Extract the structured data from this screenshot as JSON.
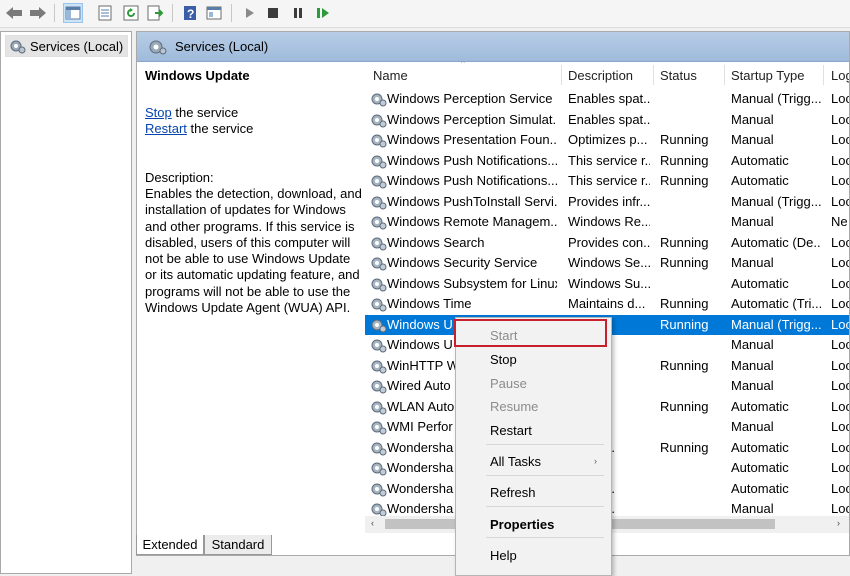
{
  "toolbar": {
    "icons": [
      "back-arrow-icon",
      "forward-arrow-icon",
      "show-hide-console-tree-icon",
      "properties-icon",
      "refresh-icon",
      "export-list-icon",
      "help-icon",
      "view-icon",
      "start-service-icon",
      "stop-service-icon",
      "pause-service-icon",
      "resume-service-icon"
    ]
  },
  "tree": {
    "item_label": "Services (Local)"
  },
  "pane": {
    "title": "Services (Local)"
  },
  "details": {
    "service_name": "Windows Update",
    "stop_link": "Stop",
    "stop_suffix": " the service",
    "restart_link": "Restart",
    "restart_suffix": " the service",
    "description_label": "Description:",
    "description_text": "Enables the detection, download, and installation of updates for Windows and other programs. If this service is disabled, users of this computer will not be able to use Windows Update or its automatic updating feature, and programs will not be able to use the Windows Update Agent (WUA) API."
  },
  "columns": [
    "Name",
    "Description",
    "Status",
    "Startup Type",
    "Log"
  ],
  "rows": [
    {
      "name": "Windows Perception Service",
      "desc": "Enables spat...",
      "status": "",
      "startup": "Manual (Trigg...",
      "log": "Loc"
    },
    {
      "name": "Windows Perception Simulat...",
      "desc": "Enables spat...",
      "status": "",
      "startup": "Manual",
      "log": "Loc"
    },
    {
      "name": "Windows Presentation Foun...",
      "desc": "Optimizes p...",
      "status": "Running",
      "startup": "Manual",
      "log": "Loc"
    },
    {
      "name": "Windows Push Notifications...",
      "desc": "This service r...",
      "status": "Running",
      "startup": "Automatic",
      "log": "Loc"
    },
    {
      "name": "Windows Push Notifications...",
      "desc": "This service r...",
      "status": "Running",
      "startup": "Automatic",
      "log": "Loc"
    },
    {
      "name": "Windows PushToInstall Servi...",
      "desc": "Provides infr...",
      "status": "",
      "startup": "Manual (Trigg...",
      "log": "Loc"
    },
    {
      "name": "Windows Remote Managem...",
      "desc": "Windows Re...",
      "status": "",
      "startup": "Manual",
      "log": "Ne"
    },
    {
      "name": "Windows Search",
      "desc": "Provides con...",
      "status": "Running",
      "startup": "Automatic (De...",
      "log": "Loc"
    },
    {
      "name": "Windows Security Service",
      "desc": "Windows Se...",
      "status": "Running",
      "startup": "Manual",
      "log": "Loc"
    },
    {
      "name": "Windows Subsystem for Linux",
      "desc": "Windows Su...",
      "status": "",
      "startup": "Automatic",
      "log": "Loc"
    },
    {
      "name": "Windows Time",
      "desc": "Maintains d...",
      "status": "Running",
      "startup": "Automatic (Tri...",
      "log": "Loc"
    },
    {
      "name": "Windows U",
      "desc": "s the ...",
      "status": "Running",
      "startup": "Manual (Trigg...",
      "log": "Loc"
    },
    {
      "name": "Windows U",
      "desc": "s rem...",
      "status": "",
      "startup": "Manual",
      "log": "Loc"
    },
    {
      "name": "WinHTTP W",
      "desc": "TP im...",
      "status": "Running",
      "startup": "Manual",
      "log": "Loc"
    },
    {
      "name": "Wired Auto",
      "desc": "ed A...",
      "status": "",
      "startup": "Manual",
      "log": "Loc"
    },
    {
      "name": "WLAN Auto",
      "desc": "ANS...",
      "status": "Running",
      "startup": "Automatic",
      "log": "Loc"
    },
    {
      "name": "WMI Perfor",
      "desc": "s per...",
      "status": "",
      "startup": "Manual",
      "log": "Loc"
    },
    {
      "name": "Wondersha",
      "desc": "ershar...",
      "status": "Running",
      "startup": "Automatic",
      "log": "Loc"
    },
    {
      "name": "Wondersha",
      "desc": "",
      "status": "",
      "startup": "Automatic",
      "log": "Loc"
    },
    {
      "name": "Wondersha",
      "desc": "ershar...",
      "status": "",
      "startup": "Automatic",
      "log": "Loc"
    },
    {
      "name": "Wondersha",
      "desc": "ershar...",
      "status": "",
      "startup": "Manual",
      "log": "Loc"
    }
  ],
  "selected_row_index": 11,
  "scroll": {
    "left_arrow": "‹",
    "right_arrow": "›"
  },
  "tabs": {
    "extended": "Extended",
    "standard": "Standard"
  },
  "context_menu": {
    "start": "Start",
    "stop": "Stop",
    "pause": "Pause",
    "resume": "Resume",
    "restart": "Restart",
    "all_tasks": "All Tasks",
    "refresh": "Refresh",
    "properties": "Properties",
    "help": "Help"
  },
  "colors": {
    "selection": "#0078d7",
    "highlight_box": "#c8202c",
    "header_gradient": "#b7cde6"
  }
}
